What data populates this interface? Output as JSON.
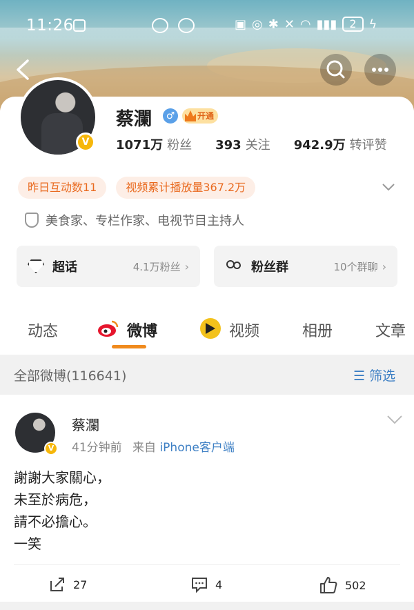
{
  "status_bar": {
    "time": "11:26",
    "battery": "2"
  },
  "profile": {
    "name": "蔡瀾",
    "vip_label": "开通",
    "followers_value": "1071万",
    "followers_label": "粉丝",
    "following_value": "393",
    "following_label": "关注",
    "interactions_value": "942.9万",
    "interactions_label": "转评赞",
    "tags": [
      "昨日互动数11",
      "视频累计播放量367.2万"
    ],
    "verification": "美食家、专栏作家、电视节目主持人"
  },
  "cards": [
    {
      "title": "超话",
      "sub": "4.1万粉丝"
    },
    {
      "title": "粉丝群",
      "sub": "10个群聊"
    }
  ],
  "tabs": [
    "动态",
    "微博",
    "视频",
    "相册",
    "文章"
  ],
  "filter_bar": {
    "count_text": "全部微博(116641)",
    "filter_label": "筛选"
  },
  "post": {
    "author": "蔡瀾",
    "time": "41分钟前",
    "from_label": "来自",
    "source": "iPhone客户端",
    "text": "謝謝大家關心，\n未至於病危，\n請不必擔心。\n一笑",
    "reposts": "27",
    "comments": "4",
    "likes": "502"
  },
  "colors": {
    "accent": "#f08a1d",
    "link": "#3d7fc4",
    "tag_bg": "#fdeee6",
    "tag_text": "#e96a1f"
  }
}
